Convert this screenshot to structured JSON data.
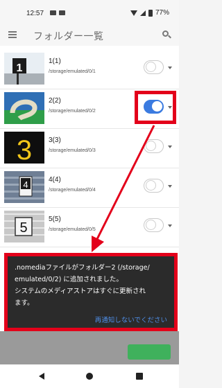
{
  "status_bar": {
    "time": "12:57",
    "battery": "77%"
  },
  "app_bar": {
    "title": "フォルダー一覧"
  },
  "folders": [
    {
      "name": "1(1)",
      "path": "/storage/emulated/0/1",
      "enabled": false
    },
    {
      "name": "2(2)",
      "path": "/storage/emulated/0/2",
      "enabled": true
    },
    {
      "name": "3(3)",
      "path": "/storage/emulated/0/3",
      "enabled": false
    },
    {
      "name": "4(4)",
      "path": "/storage/emulated/0/4",
      "enabled": false
    },
    {
      "name": "5(5)",
      "path": "/storage/emulated/0/5",
      "enabled": false
    }
  ],
  "dialog": {
    "message_line1": ".nomediaファイルがフォルダー2 (/storage/",
    "message_line2": "emulated/0/2) に追加されました。",
    "message_line3": "システムのメディアストアはすぐに更新され",
    "message_line4": "ます。",
    "action": "再通知しないでください"
  },
  "colors": {
    "accent": "#3b7be0",
    "annotation": "#e3001a",
    "dialog_bg": "#2b2b2b",
    "link": "#4f8fe8"
  }
}
